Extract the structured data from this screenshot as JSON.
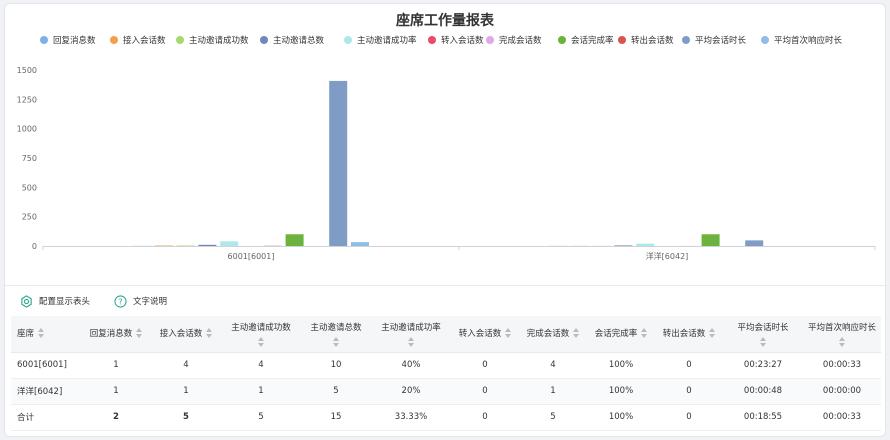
{
  "chart_data": {
    "type": "bar",
    "title": "座席工作量报表",
    "categories": [
      "6001[6001]",
      "洋洋[6042]"
    ],
    "ylim": [
      0,
      1500
    ],
    "yticks": [
      0,
      250,
      500,
      750,
      1000,
      1250,
      1500
    ],
    "legend_position": "top",
    "grid": false,
    "series": [
      {
        "name": "回复消息数",
        "color": "#7eb0e6",
        "values": [
          1,
          1
        ]
      },
      {
        "name": "接入会话数",
        "color": "#f0a04b",
        "values": [
          4,
          1
        ]
      },
      {
        "name": "主动邀请成功数",
        "color": "#a7d86f",
        "values": [
          4,
          1
        ]
      },
      {
        "name": "主动邀请总数",
        "color": "#6e88b8",
        "values": [
          10,
          5
        ]
      },
      {
        "name": "主动邀请成功率",
        "color": "#aee8ea",
        "values": [
          40,
          20
        ]
      },
      {
        "name": "转入会话数",
        "color": "#e84a6b",
        "values": [
          0,
          0
        ]
      },
      {
        "name": "完成会话数",
        "color": "#dfa9e8",
        "values": [
          4,
          1
        ]
      },
      {
        "name": "会话完成率",
        "color": "#6cb33e",
        "values": [
          100,
          100
        ]
      },
      {
        "name": "转出会话数",
        "color": "#d9534f",
        "values": [
          0,
          0
        ]
      },
      {
        "name": "平均会话时长",
        "color": "#7f9cc4",
        "values": [
          1407,
          48
        ]
      },
      {
        "name": "平均首次响应时长",
        "color": "#8fbde8",
        "values": [
          33,
          0
        ]
      }
    ]
  },
  "toolbar": {
    "config_label": "配置显示表头",
    "config_icon": "gear-icon",
    "help_label": "文字说明",
    "help_icon": "question-circle-icon"
  },
  "table": {
    "headers": [
      "座席",
      "回复消息数",
      "接入会话数",
      "主动邀请成功数",
      "主动邀请总数",
      "主动邀请成功率",
      "转入会话数",
      "完成会话数",
      "会话完成率",
      "转出会话数",
      "平均会话时长",
      "平均首次响应时长"
    ],
    "rows": [
      [
        "6001[6001]",
        "1",
        "4",
        "4",
        "10",
        "40%",
        "0",
        "4",
        "100%",
        "0",
        "00:23:27",
        "00:00:33"
      ],
      [
        "洋洋[6042]",
        "1",
        "1",
        "1",
        "5",
        "20%",
        "0",
        "1",
        "100%",
        "0",
        "00:00:48",
        "00:00:00"
      ]
    ],
    "total": [
      "合计",
      "2",
      "5",
      "5",
      "15",
      "33.33%",
      "0",
      "5",
      "100%",
      "0",
      "00:18:55",
      "00:00:33"
    ]
  }
}
